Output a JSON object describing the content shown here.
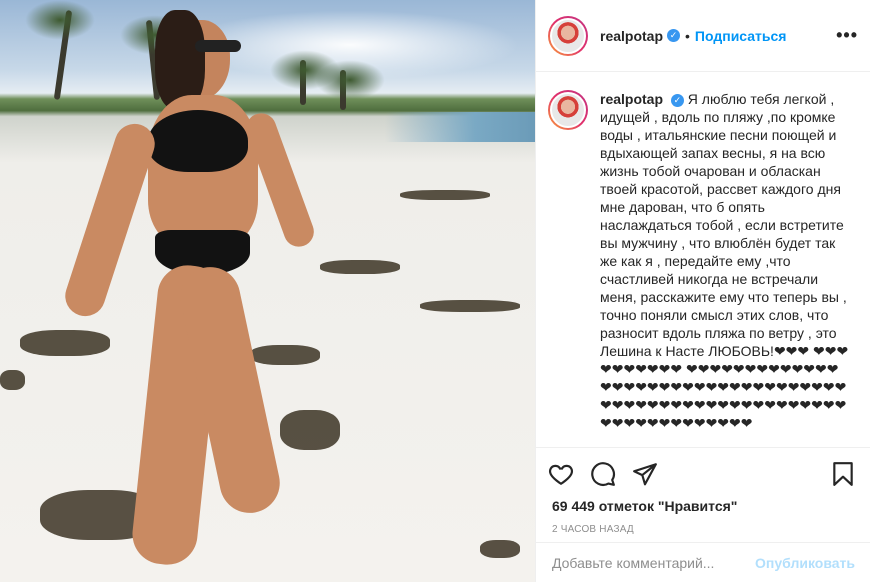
{
  "post": {
    "username": "realpotap",
    "follow_label": "Подписаться",
    "more_label": "•••",
    "caption_user": "realpotap",
    "caption_text": "Я люблю тебя легкой , идущей , вдоль по пляжу ,по кромке воды , итальянские песни поющей и вдыхающей запах весны, я на всю жизнь тобой очарован и обласкан твоей красотой, рассвет каждого дня мне дарован, что б опять наслаждаться тобой , если встретите вы мужчину , что влюблён будет так же как я , передайте ему ,что счастливей никогда не встречали меня, расскажите ему что теперь вы , точно поняли смысл этих слов, что разносит вдоль пляжа по ветру , это Лешина к Насте ЛЮБОВЬ!❤❤❤ ❤❤❤❤❤❤❤❤❤❤ ❤❤❤❤❤❤❤❤❤❤❤❤❤❤❤❤❤❤❤❤❤❤❤❤❤❤❤❤❤❤❤❤❤❤❤❤❤❤❤❤❤❤❤❤❤❤❤❤❤❤❤❤❤❤❤❤❤❤❤❤❤❤❤❤❤❤❤❤",
    "likes": "69 449 отметок \"Нравится\"",
    "time": "2 часов назад",
    "comment_placeholder": "Добавьте комментарий...",
    "post_label": "Опубликовать"
  },
  "icons": {
    "like": "heart-icon",
    "comment": "comment-icon",
    "share": "share-icon",
    "save": "bookmark-icon",
    "verified": "verified-badge-icon"
  },
  "colors": {
    "accent": "#0095f6",
    "verified": "#3897f0",
    "post_disabled": "#b2dffc",
    "muted": "#8e8e8e"
  }
}
